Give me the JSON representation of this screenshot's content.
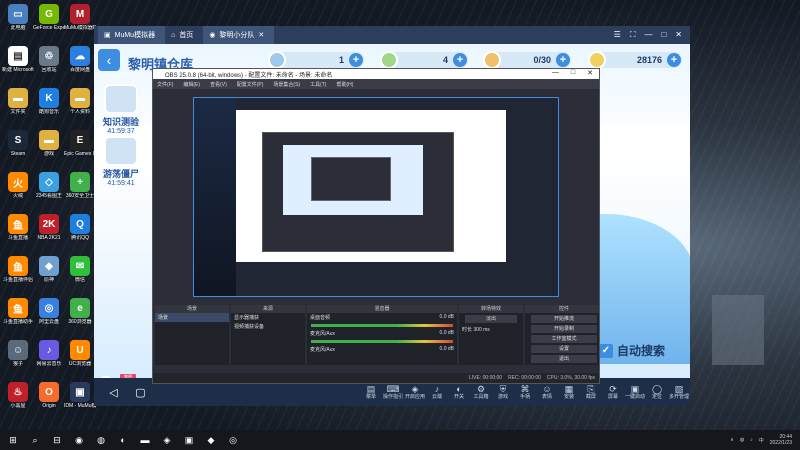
{
  "desktop_icons": [
    {
      "label": "此电脑",
      "color": "#4a7fc1",
      "glyph": "▭"
    },
    {
      "label": "GeForce Experience",
      "color": "#76b900",
      "glyph": "G"
    },
    {
      "label": "MuMu模拟器Pro",
      "color": "#b0212e",
      "glyph": "M"
    },
    {
      "label": "新建 Microsoft...",
      "color": "#ffffff",
      "glyph": "▤"
    },
    {
      "label": "回收站",
      "color": "#6b7a8a",
      "glyph": "♲"
    },
    {
      "label": "百度网盘",
      "color": "#2a7fe0",
      "glyph": "☁"
    },
    {
      "label": "文件夹",
      "color": "#e0b040",
      "glyph": "▬"
    },
    {
      "label": "酷狗音乐",
      "color": "#1e7fe0",
      "glyph": "K"
    },
    {
      "label": "个人资料",
      "color": "#e0b040",
      "glyph": "▬"
    },
    {
      "label": "Steam",
      "color": "#1b2838",
      "glyph": "S"
    },
    {
      "label": "游戏",
      "color": "#e0b040",
      "glyph": "▬"
    },
    {
      "label": "Epic Games Launcher",
      "color": "#222222",
      "glyph": "E"
    },
    {
      "label": "火绒",
      "color": "#ff8a00",
      "glyph": "火"
    },
    {
      "label": "2345看图王",
      "color": "#3aa0e0",
      "glyph": "◇"
    },
    {
      "label": "360安全卫士",
      "color": "#3fb04a",
      "glyph": "+"
    },
    {
      "label": "斗鱼直播",
      "color": "#ff8a00",
      "glyph": "鱼"
    },
    {
      "label": "NBA 2K21",
      "color": "#c0202a",
      "glyph": "2K"
    },
    {
      "label": "腾讯QQ",
      "color": "#1e7fe0",
      "glyph": "Q"
    },
    {
      "label": "斗鱼直播伴侣",
      "color": "#ff8a00",
      "glyph": "鱼"
    },
    {
      "label": "原神",
      "color": "#6fa0d0",
      "glyph": "◆"
    },
    {
      "label": "微信",
      "color": "#2fbf3a",
      "glyph": "✉"
    },
    {
      "label": "斗鱼直播助手",
      "color": "#ff8a00",
      "glyph": "鱼"
    },
    {
      "label": "阿里云盘",
      "color": "#3a7fe0",
      "glyph": "◎"
    },
    {
      "label": "360浏览器",
      "color": "#3fb04a",
      "glyph": "e"
    },
    {
      "label": "猴子",
      "color": "#5a6a7a",
      "glyph": "☺"
    },
    {
      "label": "网易云音乐",
      "color": "#6a5ae0",
      "glyph": "♪"
    },
    {
      "label": "UC浏览器",
      "color": "#ff8a00",
      "glyph": "U"
    },
    {
      "label": "小黑屋",
      "color": "#c0202a",
      "glyph": "♨"
    },
    {
      "label": "Origin",
      "color": "#f56c2d",
      "glyph": "O"
    },
    {
      "label": "IDM - MuMu模拟器",
      "color": "#2a3a5a",
      "glyph": "▣"
    }
  ],
  "mumu": {
    "brand": "MuMu模拟器",
    "tabs": [
      {
        "label": "首页"
      },
      {
        "label": "黎明小分队"
      }
    ],
    "controls": [
      "☰",
      "⛶",
      "—",
      "□",
      "✕"
    ],
    "game": {
      "title": "黎明镇仓库",
      "resources": [
        {
          "value": "1",
          "icon_color": "#9ec9ea"
        },
        {
          "value": "4",
          "icon_color": "#9fd88a"
        },
        {
          "value": "0/30",
          "icon_color": "#f0c06a"
        },
        {
          "value": "28176",
          "icon_color": "#f0d060"
        }
      ],
      "side_buttons": [
        {
          "label": "知识测验",
          "time": "41:59:37"
        },
        {
          "label": "游荡僵尸",
          "time": "41:59:41"
        }
      ],
      "auto_search": "自动搜索",
      "red_btns": [
        "黎明",
        "黎明"
      ]
    },
    "nav": {
      "back": "◁",
      "home": "▢"
    },
    "tools": [
      {
        "icon": "▤",
        "label": "菜单"
      },
      {
        "icon": "⌨",
        "label": "操作指引"
      },
      {
        "icon": "◈",
        "label": "开启应用"
      },
      {
        "icon": "♪",
        "label": "云端"
      },
      {
        "icon": "◐",
        "label": "开关"
      },
      {
        "icon": "⚙",
        "label": "工具箱"
      },
      {
        "icon": "⛨",
        "label": "游戏"
      },
      {
        "icon": "⌘",
        "label": "手柄"
      },
      {
        "icon": "☺",
        "label": "表情"
      },
      {
        "icon": "▦",
        "label": "安装"
      },
      {
        "icon": "⎘",
        "label": "截屏"
      },
      {
        "icon": "⟳",
        "label": "屏幕"
      },
      {
        "icon": "▣",
        "label": "一键启动"
      },
      {
        "icon": "◯",
        "label": "定位"
      },
      {
        "icon": "▧",
        "label": "多开管理"
      }
    ]
  },
  "obs": {
    "title": "OBS 25.0.8 (64-bit, windows) - 配置文件: 未命名 - 场景: 未命名",
    "window_controls": [
      "—",
      "□",
      "✕"
    ],
    "menu": [
      "文件(F)",
      "编辑(E)",
      "查看(V)",
      "配置文件(P)",
      "场景集合(S)",
      "工具(T)",
      "帮助(H)"
    ],
    "docks": {
      "scenes": {
        "title": "场景",
        "items": [
          "场景"
        ]
      },
      "sources": {
        "title": "来源",
        "items": [
          "显示器捕获",
          "视频捕获设备"
        ]
      },
      "mixer": {
        "title": "混音器",
        "channels": [
          {
            "name": "桌面音频",
            "db": "0.0 dB"
          },
          {
            "name": "麦克风/Aux",
            "db": "0.0 dB"
          },
          {
            "name": "麦克风/Aux",
            "db": "0.0 dB"
          }
        ]
      },
      "transitions": {
        "title": "转场特效",
        "type": "淡出",
        "duration_label": "时长",
        "duration": "300 ms"
      },
      "controls": {
        "title": "控件",
        "buttons": [
          "开始推流",
          "开始录制",
          "工作室模式",
          "设置",
          "退出"
        ]
      }
    },
    "status": {
      "live": "LIVE: 00:00:00",
      "rec": "REC: 00:00:00",
      "cpu": "CPU: 3.0%, 30.00 fps"
    }
  },
  "taskbar": {
    "start": "⊞",
    "apps": [
      "⌕",
      "⊟",
      "◉",
      "◍",
      "◐",
      "▬",
      "◈",
      "▣",
      "◆",
      "◎"
    ],
    "tray": [
      "∧",
      "◍",
      "♪",
      "中"
    ],
    "time": "20:44",
    "date": "2022/1/23"
  }
}
